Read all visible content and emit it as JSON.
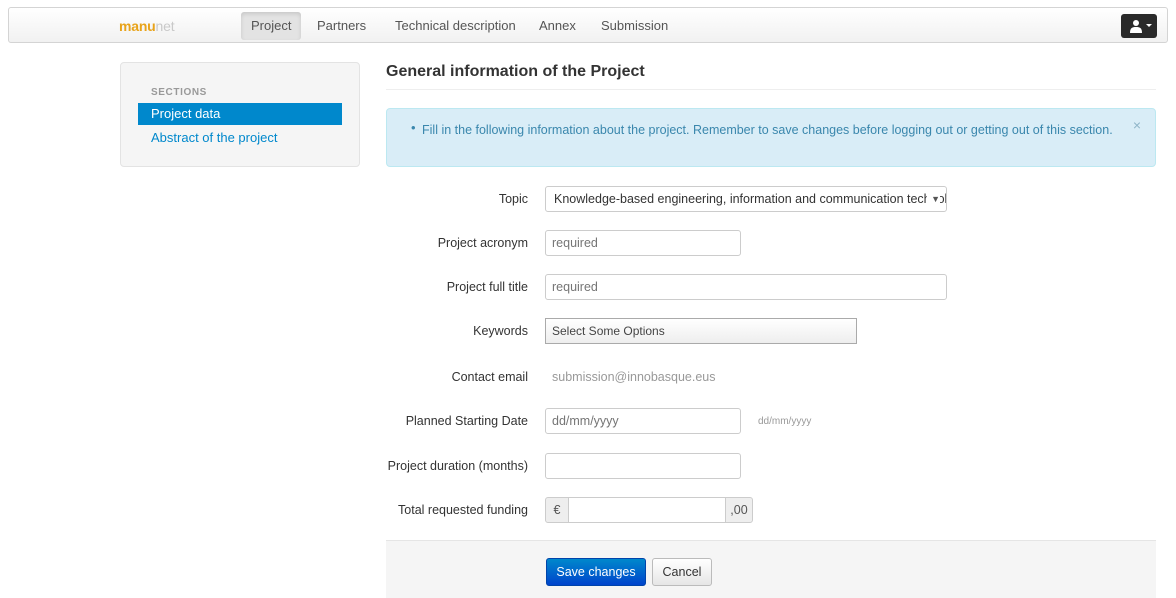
{
  "brand": {
    "part1": "manu",
    "part2": "net"
  },
  "nav": {
    "items": [
      {
        "label": "Project",
        "active": true
      },
      {
        "label": "Partners",
        "active": false
      },
      {
        "label": "Technical description",
        "active": false
      },
      {
        "label": "Annex",
        "active": false
      },
      {
        "label": "Submission",
        "active": false
      }
    ]
  },
  "sidebar": {
    "header": "SECTIONS",
    "items": [
      {
        "label": "Project data",
        "active": true
      },
      {
        "label": "Abstract of the project",
        "active": false
      }
    ]
  },
  "main": {
    "title": "General information of the Project",
    "alert": {
      "bullet": "•",
      "text": "Fill in the following information about the project. Remember to save changes before logging out or getting out of this section.",
      "close": "×"
    },
    "fields": {
      "topic": {
        "label": "Topic",
        "value": "Knowledge-based engineering, information and communication technologies"
      },
      "acronym": {
        "label": "Project acronym",
        "placeholder": "required"
      },
      "full_title": {
        "label": "Project full title",
        "placeholder": "required"
      },
      "keywords": {
        "label": "Keywords",
        "value": "Select Some Options"
      },
      "contact_email": {
        "label": "Contact email",
        "value": "submission@innobasque.eus"
      },
      "start_date": {
        "label": "Planned Starting Date",
        "placeholder": "dd/mm/yyyy",
        "hint": "dd/mm/yyyy"
      },
      "duration": {
        "label": "Project duration (months)",
        "value": ""
      },
      "funding": {
        "label": "Total requested funding",
        "prefix": "€",
        "suffix": ",00",
        "value": ""
      }
    },
    "actions": {
      "save": "Save changes",
      "cancel": "Cancel"
    }
  },
  "colors": {
    "primary": "#0088cc",
    "alert_bg": "#d9edf7",
    "brand_orange": "#e8a31a"
  }
}
